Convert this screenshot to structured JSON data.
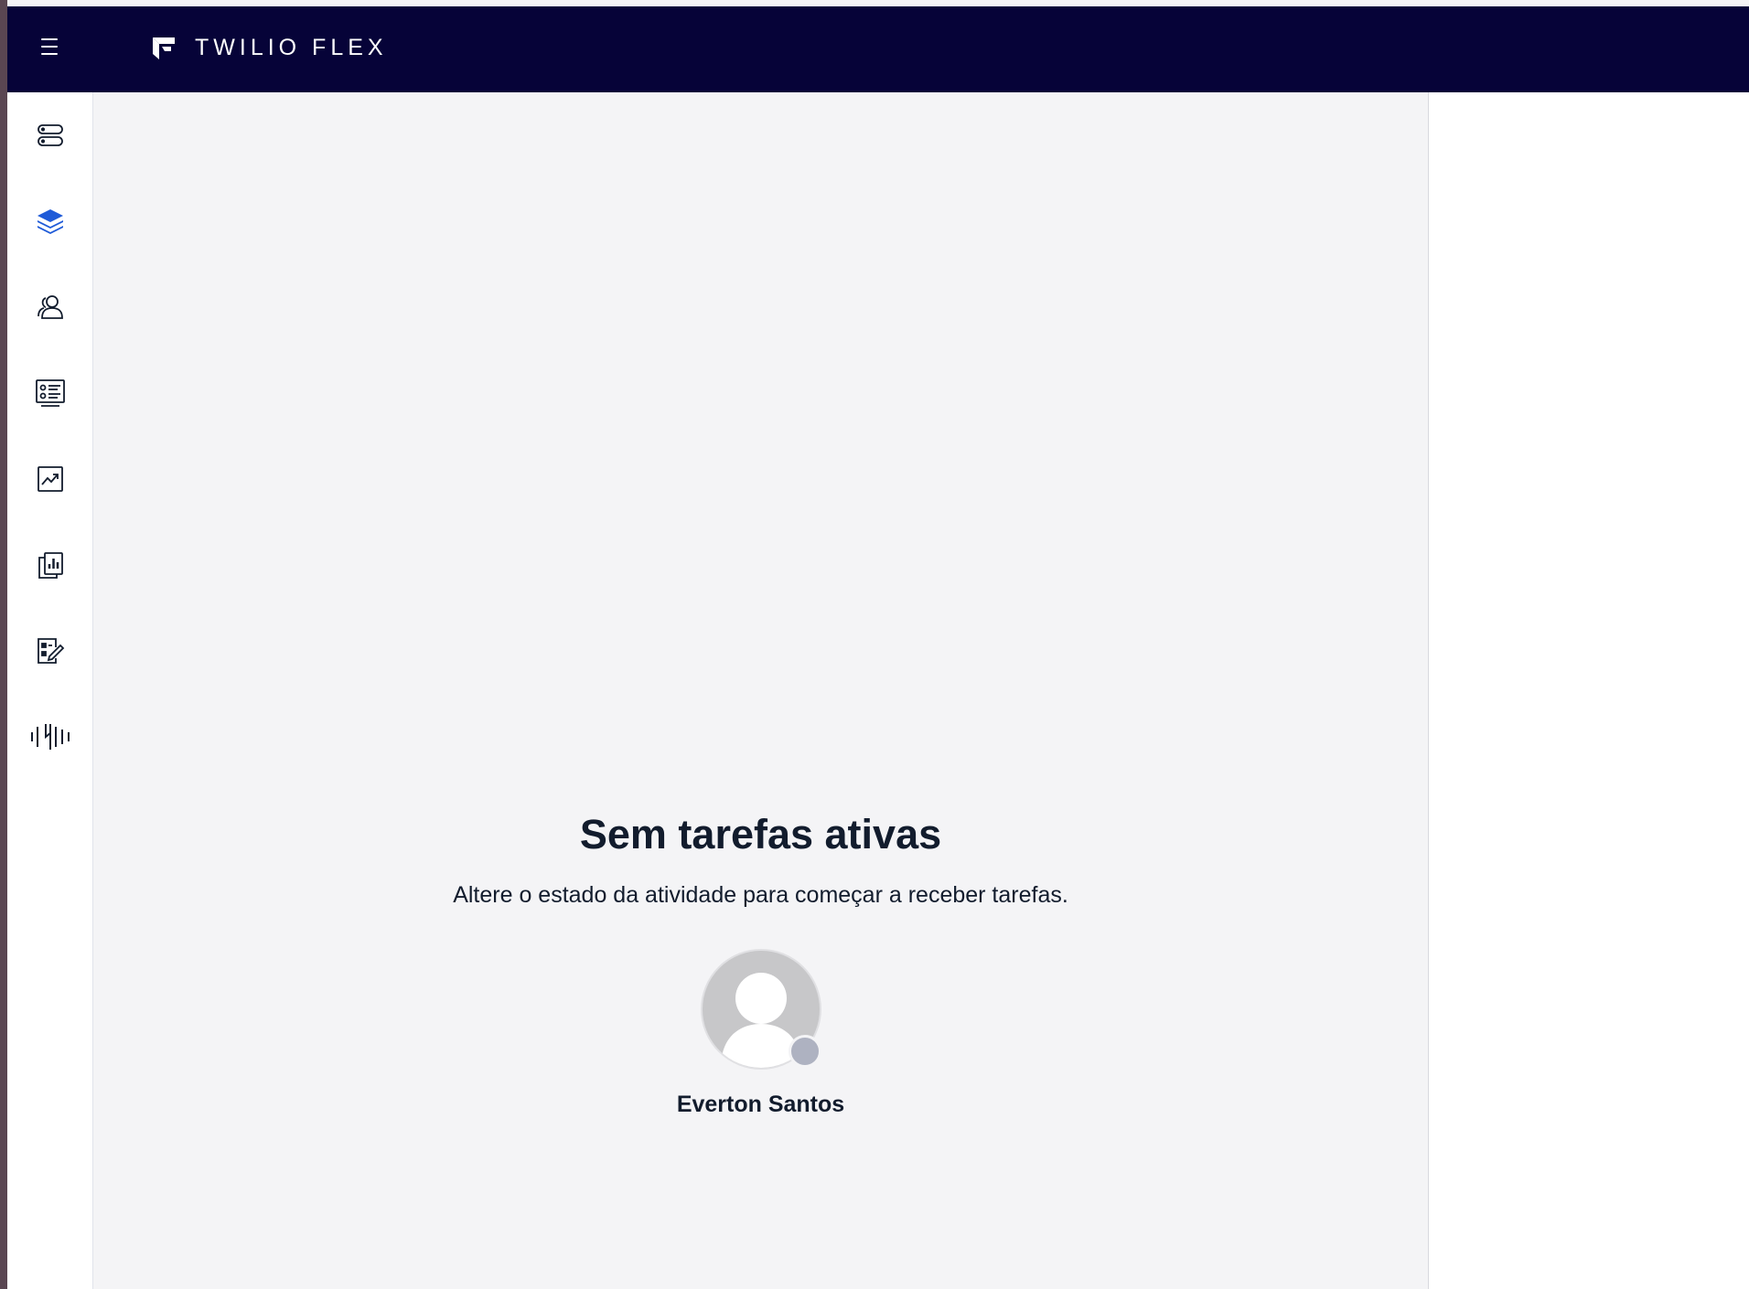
{
  "app": {
    "brand": "TWILIO FLEX",
    "menu_icon": "hamburger-menu-icon"
  },
  "sidebar": {
    "items": [
      {
        "id": "tasks",
        "icon": "stack-cards-icon",
        "active": false
      },
      {
        "id": "layers",
        "icon": "layers-icon",
        "active": true
      },
      {
        "id": "teams",
        "icon": "users-icon",
        "active": false
      },
      {
        "id": "queues",
        "icon": "list-board-icon",
        "active": false
      },
      {
        "id": "insights",
        "icon": "trend-chart-icon",
        "active": false
      },
      {
        "id": "reports",
        "icon": "bar-report-icon",
        "active": false
      },
      {
        "id": "quality",
        "icon": "edit-form-icon",
        "active": false
      },
      {
        "id": "audio",
        "icon": "waveform-icon",
        "active": false
      }
    ]
  },
  "main": {
    "empty_title": "Sem tarefas ativas",
    "empty_subtitle": "Altere o estado da atividade para começar a receber tarefas.",
    "user_name": "Everton Santos"
  },
  "colors": {
    "topbar": "#060338",
    "active_icon": "#1f5bd8",
    "icon": "#121c2d",
    "status_offline": "#aeb2c1"
  }
}
